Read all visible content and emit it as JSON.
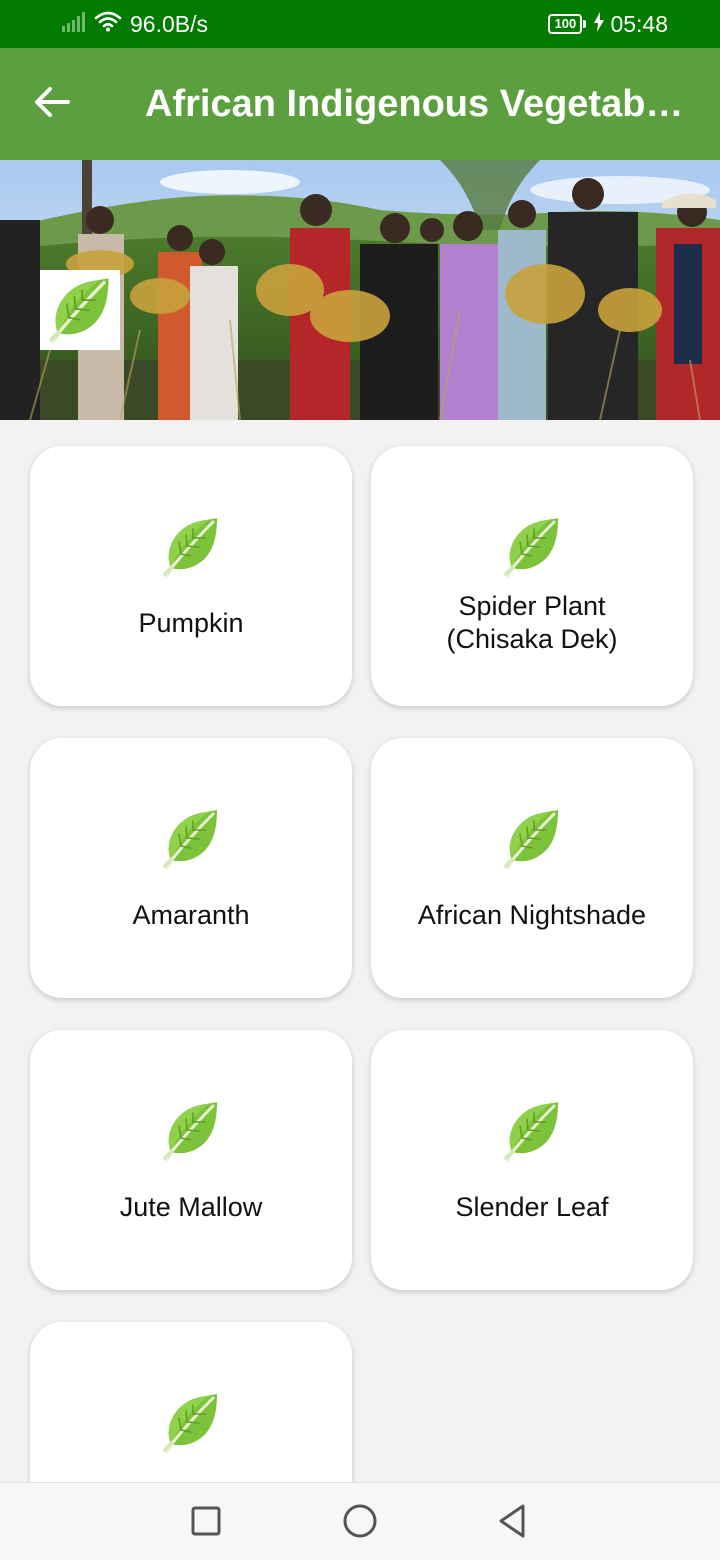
{
  "status_bar": {
    "network_speed": "96.0B/s",
    "battery_level": "100",
    "time": "05:48",
    "icons": [
      "signal-icon",
      "wifi-icon",
      "battery-icon",
      "charging-icon"
    ]
  },
  "app_bar": {
    "title": "African Indigenous Vegetable...",
    "back_icon": "arrow-left-icon"
  },
  "hero": {
    "badge_icon": "leafy-green-icon"
  },
  "vegetables": [
    {
      "label": "Pumpkin",
      "icon": "leafy-green-icon"
    },
    {
      "label": "Spider Plant (Chisaka Dek)",
      "icon": "leafy-green-icon"
    },
    {
      "label": "Amaranth",
      "icon": "leafy-green-icon"
    },
    {
      "label": "African Nightshade",
      "icon": "leafy-green-icon"
    },
    {
      "label": "Jute Mallow",
      "icon": "leafy-green-icon"
    },
    {
      "label": "Slender Leaf",
      "icon": "leafy-green-icon"
    },
    {
      "label": "",
      "icon": "leafy-green-icon"
    }
  ],
  "nav_bar": {
    "icons": [
      "recent-apps-icon",
      "home-icon",
      "back-icon"
    ]
  },
  "colors": {
    "status_bar": "#017c00",
    "app_bar": "#5b9f3f",
    "background": "#f2f2f2",
    "card": "#ffffff"
  }
}
